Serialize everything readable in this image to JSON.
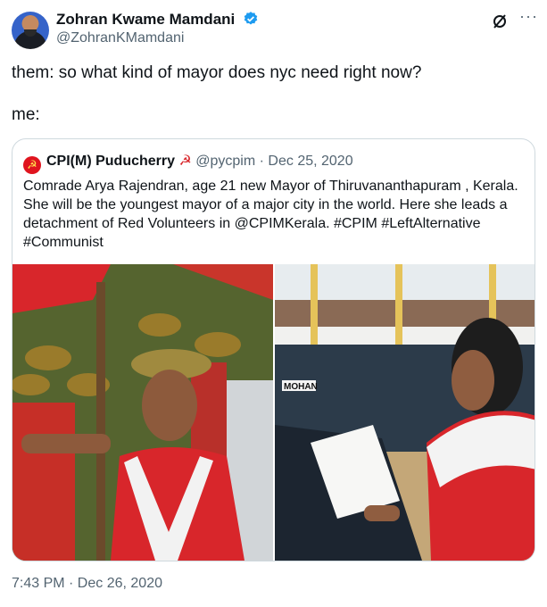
{
  "author": {
    "name": "Zohran Kwame Mamdani",
    "handle": "@ZohranKMamdani"
  },
  "tweet": {
    "line1": "them: so what kind of mayor does nyc need right now?",
    "line2": "me:",
    "timestamp": "7:43 PM · Dec 26, 2020"
  },
  "quote": {
    "name": "CPI(M) Puducherry",
    "emoji": "☭",
    "handle": "@pycpim",
    "date": "· Dec 25, 2020",
    "body": "Comrade Arya Rajendran, age 21  new Mayor of Thiruvananthapuram , Kerala. She will be the youngest mayor of a major city in the world. Here she leads a detachment of Red Volunteers in @CPIMKerala. #CPIM  #LeftAlternative #Communist",
    "image2_sign": "MOHAN"
  },
  "colors": {
    "verified": "#1d9bf0",
    "red": "#d8262b",
    "muted": "#536471"
  },
  "icons": [
    "verified-icon",
    "grok-icon",
    "more-icon",
    "hammer-sickle-icon"
  ]
}
